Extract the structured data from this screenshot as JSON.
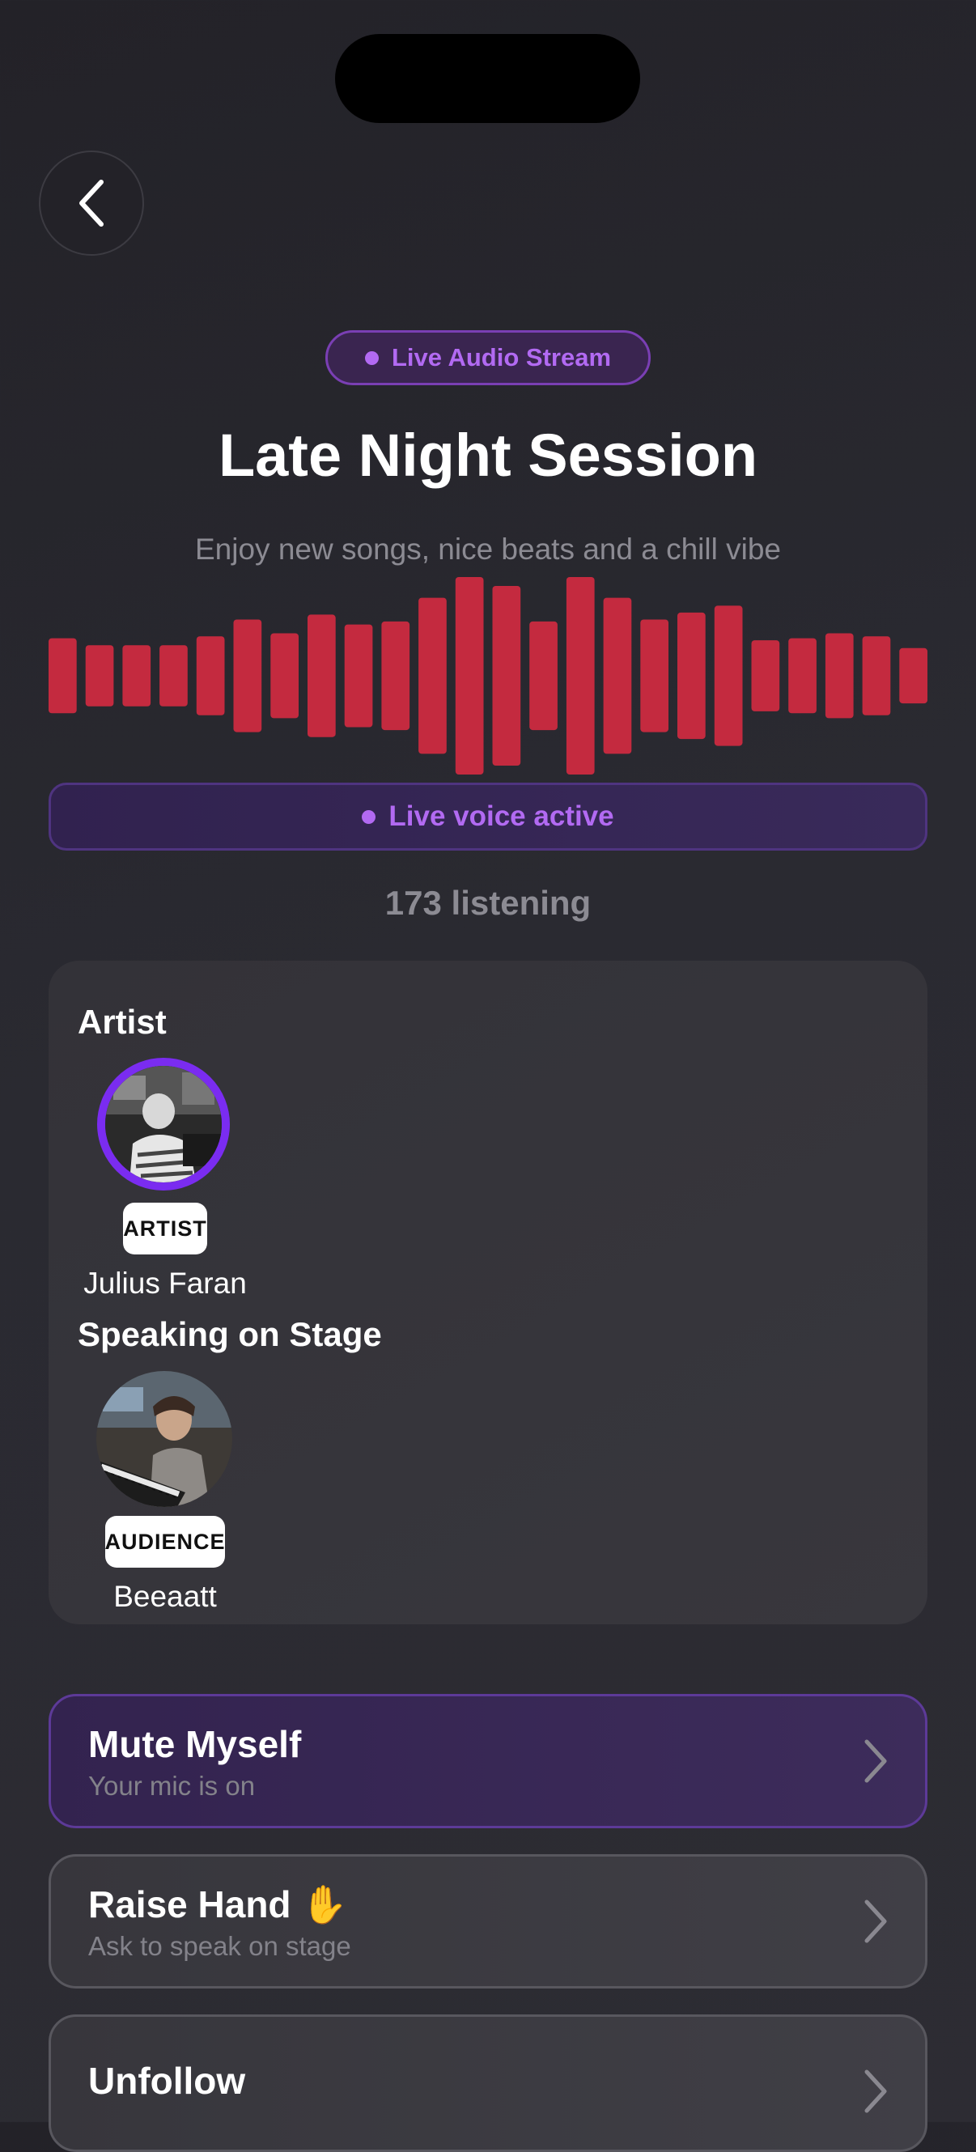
{
  "header": {
    "pill_label": "Live Audio Stream",
    "title": "Late Night Session",
    "subtitle": "Enjoy new songs, nice beats and a chill vibe"
  },
  "colors": {
    "accent_purple": "#b26af2",
    "waveform_red": "#c42a3f",
    "avatar_ring": "#7a2cf0"
  },
  "waveform": {
    "levels": [
      0.38,
      0.31,
      0.31,
      0.31,
      0.4,
      0.57,
      0.43,
      0.62,
      0.52,
      0.55,
      0.79,
      1.0,
      0.91,
      0.55,
      1.0,
      0.79,
      0.57,
      0.64,
      0.71,
      0.36,
      0.38,
      0.43,
      0.4,
      0.28
    ]
  },
  "status": {
    "voice_label": "Live voice active",
    "listening": "173 listening"
  },
  "stage": {
    "artist_section": "Artist",
    "artist": {
      "badge": "ARTIST",
      "name": "Julius Faran"
    },
    "speakers_section": "Speaking on Stage",
    "speaker": {
      "badge": "AUDIENCE",
      "name": "Beeaatt"
    }
  },
  "actions": {
    "mute": {
      "title": "Mute Myself",
      "subtitle": "Your mic is on"
    },
    "raise_hand": {
      "title": "Raise Hand",
      "emoji": "✋",
      "subtitle": "Ask to speak on stage"
    },
    "unfollow": {
      "title": "Unfollow"
    }
  },
  "icons": {
    "back": "chevron-left-icon",
    "row_chevron": "chevron-right-icon"
  }
}
